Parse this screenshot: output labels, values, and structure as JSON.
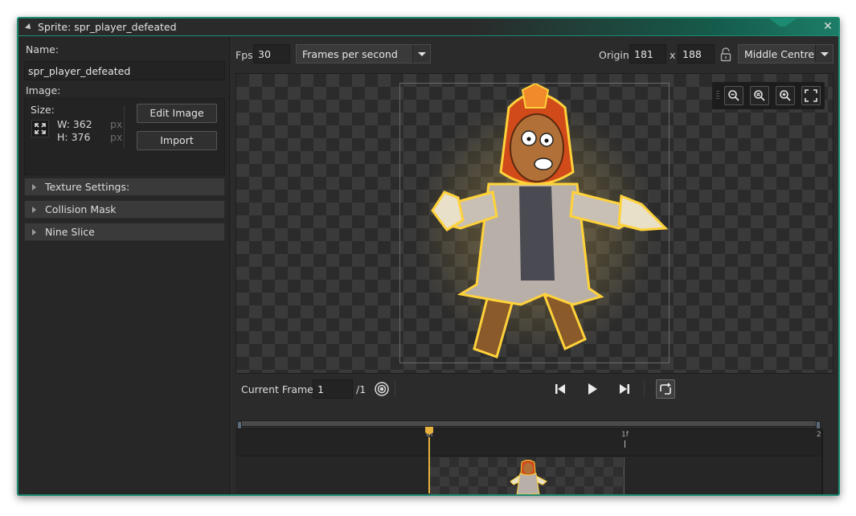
{
  "window": {
    "title": "Sprite: spr_player_defeated",
    "close_glyph": "✕",
    "accent": "#1d8a72"
  },
  "left_panel": {
    "name_label": "Name:",
    "name_value": "spr_player_defeated",
    "image_label": "Image:",
    "size_label": "Size:",
    "width_text": "W: 362",
    "height_text": "H: 376",
    "unit": "px",
    "edit_image_button": "Edit Image",
    "import_button": "Import",
    "sections": [
      "Texture Settings:",
      "Collision Mask",
      "Nine Slice"
    ]
  },
  "toolbar": {
    "fps_label": "Fps",
    "fps_value": "30",
    "fps_mode": "Frames per second",
    "origin_label": "Origin",
    "origin_x": "181",
    "origin_separator": "x",
    "origin_y": "188",
    "origin_preset": "Middle Centre"
  },
  "playback": {
    "current_frame_label": "Current Frame:",
    "current_frame_value": "1",
    "frame_total": "/1"
  },
  "timeline": {
    "ticks": [
      "0f",
      "1f",
      "2"
    ],
    "playhead_color": "#e7b13e"
  },
  "icons": {
    "size_fit": "expand-icon",
    "lock": "lock-icon",
    "zoom_out": "zoom-out-icon",
    "zoom_reset": "zoom-reset-icon",
    "zoom_in": "zoom-in-icon",
    "fullscreen": "fullscreen-icon",
    "onion": "onion-skin-icon",
    "prev": "skip-back-icon",
    "play": "play-icon",
    "next": "skip-forward-icon",
    "loop": "loop-icon"
  }
}
